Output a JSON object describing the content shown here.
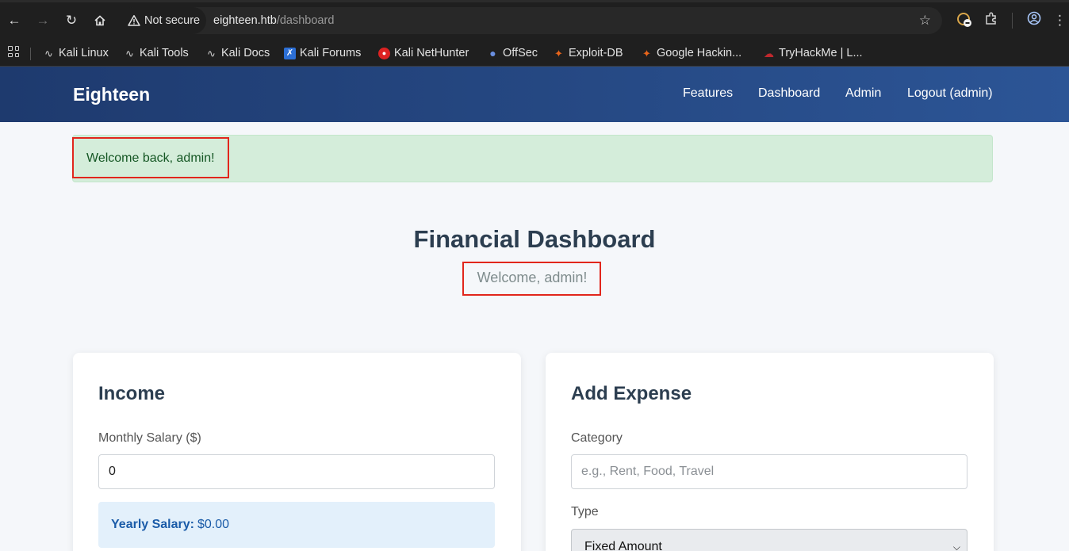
{
  "browser": {
    "secure_label": "Not secure",
    "url_host": "eighteen.htb",
    "url_path": "/dashboard",
    "icons": [
      "back-icon",
      "forward-icon",
      "reload-icon",
      "home-icon",
      "warning-icon",
      "star-icon",
      "extension-icon",
      "puzzle-icon",
      "profile-icon",
      "menu-icon"
    ]
  },
  "bookmarks": [
    {
      "label": "Kali Linux",
      "icon": "kali-icon"
    },
    {
      "label": "Kali Tools",
      "icon": "kali-icon"
    },
    {
      "label": "Kali Docs",
      "icon": "kali-icon"
    },
    {
      "label": "Kali Forums",
      "icon": "kali-forums-icon"
    },
    {
      "label": "Kali NetHunter",
      "icon": "nethunter-icon"
    },
    {
      "label": "OffSec",
      "icon": "offsec-icon"
    },
    {
      "label": "Exploit-DB",
      "icon": "exploitdb-icon"
    },
    {
      "label": "Google Hackin...",
      "icon": "exploitdb-icon"
    },
    {
      "label": "TryHackMe | L...",
      "icon": "tryhackme-icon"
    }
  ],
  "site": {
    "brand": "Eighteen",
    "nav": {
      "features": "Features",
      "dashboard": "Dashboard",
      "admin": "Admin",
      "logout": "Logout (admin)"
    },
    "colors": {
      "nav_start": "#1e3a6e",
      "nav_end": "#2c5596",
      "alert_bg": "#d4edda",
      "highlight": "#e1261c"
    }
  },
  "alert": {
    "message": "Welcome back, admin!"
  },
  "header": {
    "title": "Financial Dashboard",
    "subtitle": "Welcome, admin!"
  },
  "income": {
    "title": "Income",
    "salary_label": "Monthly Salary ($)",
    "salary_value": "0",
    "yearly_label": "Yearly Salary:",
    "yearly_value": "$0.00"
  },
  "expense": {
    "title": "Add Expense",
    "category_label": "Category",
    "category_placeholder": "e.g., Rent, Food, Travel",
    "type_label": "Type",
    "type_selected": "Fixed Amount"
  }
}
